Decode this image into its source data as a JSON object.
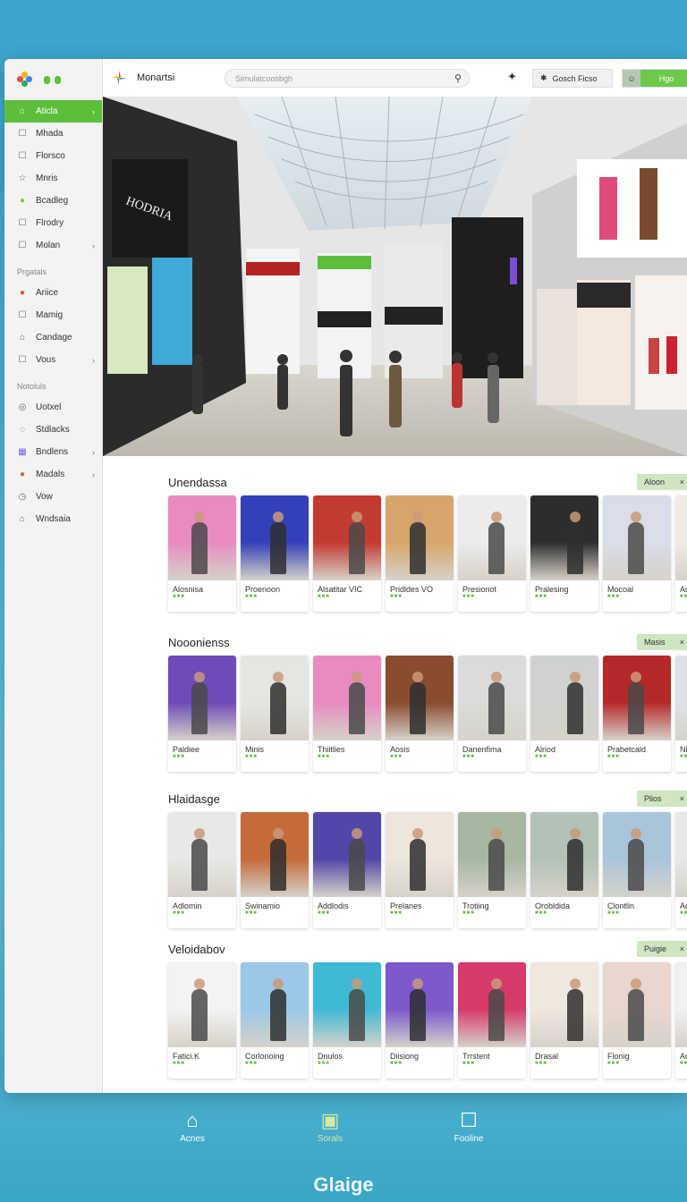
{
  "header": {
    "app_title": "Monartsi",
    "search_placeholder": "Simulatcoosbgh",
    "user_button": "Gosch Ficso",
    "sign_button": "Hgo"
  },
  "sidebar": {
    "items_top": [
      {
        "label": "Aticla",
        "icon": "home-icon",
        "active": true,
        "chevron": true
      },
      {
        "label": "Mhada",
        "icon": "note-icon",
        "active": false,
        "chevron": false
      },
      {
        "label": "Florsco",
        "icon": "box-icon",
        "active": false,
        "chevron": false
      },
      {
        "label": "Mnris",
        "icon": "star-icon",
        "active": false,
        "chevron": false
      },
      {
        "label": "Bcadleg",
        "icon": "ball-icon",
        "active": false,
        "chevron": false
      },
      {
        "label": "Flrodry",
        "icon": "doc-icon",
        "active": false,
        "chevron": false
      },
      {
        "label": "Molan",
        "icon": "bag-icon",
        "active": false,
        "chevron": true
      }
    ],
    "section1": "Prgatals",
    "items_mid": [
      {
        "label": "Ariice",
        "icon": "fruit-icon",
        "chevron": false
      },
      {
        "label": "Mamig",
        "icon": "note-icon",
        "chevron": false
      },
      {
        "label": "Candage",
        "icon": "home-icon",
        "chevron": false
      },
      {
        "label": "Vous",
        "icon": "box-icon",
        "chevron": true
      }
    ],
    "section2": "Notoluls",
    "items_bottom": [
      {
        "label": "Uotxel",
        "icon": "eye-icon",
        "chevron": false
      },
      {
        "label": "Stdlacks",
        "icon": "chat-icon",
        "chevron": false
      },
      {
        "label": "Bndlens",
        "icon": "grid-icon",
        "chevron": true
      },
      {
        "label": "Madals",
        "icon": "pin-icon",
        "chevron": true
      },
      {
        "label": "Vow",
        "icon": "clock-icon",
        "chevron": false
      },
      {
        "label": "Wndsaia",
        "icon": "home-icon",
        "chevron": false
      }
    ]
  },
  "sections": [
    {
      "title": "Unendassa",
      "button": "Aloon",
      "cards": [
        "Alosnisa",
        "Proenoon",
        "Alsatitar VIC",
        "Pridldes VO",
        "Presionot",
        "Pralesing",
        "Mocoal",
        "Adora"
      ]
    },
    {
      "title": "Nooonienss",
      "button": "Masis",
      "cards": [
        "Paldiee",
        "Minis",
        "Thiitlies",
        "Aosis",
        "Danenfima",
        "Alriod",
        "Prabetcald",
        "Nisao"
      ]
    },
    {
      "title": "Hlaidasge",
      "button": "Plios",
      "cards": [
        "Adlomin",
        "Swinamio",
        "Addlodis",
        "Prelanes",
        "Trotiing",
        "Orobldida",
        "Clontlin",
        "Aclosin"
      ]
    },
    {
      "title": "Veloidabov",
      "button": "Puigie",
      "cards": [
        "Fatici.K",
        "Corlonoing",
        "Dnulos",
        "Diisiong",
        "Trrstent",
        "Drasal",
        "Flonig",
        "Acsel"
      ]
    }
  ],
  "bottom_nav": [
    {
      "label": "Acnes",
      "icon": "home-icon"
    },
    {
      "label": "Sorals",
      "icon": "store-icon"
    },
    {
      "label": "Fooline",
      "icon": "basket-icon"
    }
  ],
  "brand": "Glaige",
  "colors": {
    "accent": "#5cbf3a",
    "background": "#3aa4cf"
  }
}
